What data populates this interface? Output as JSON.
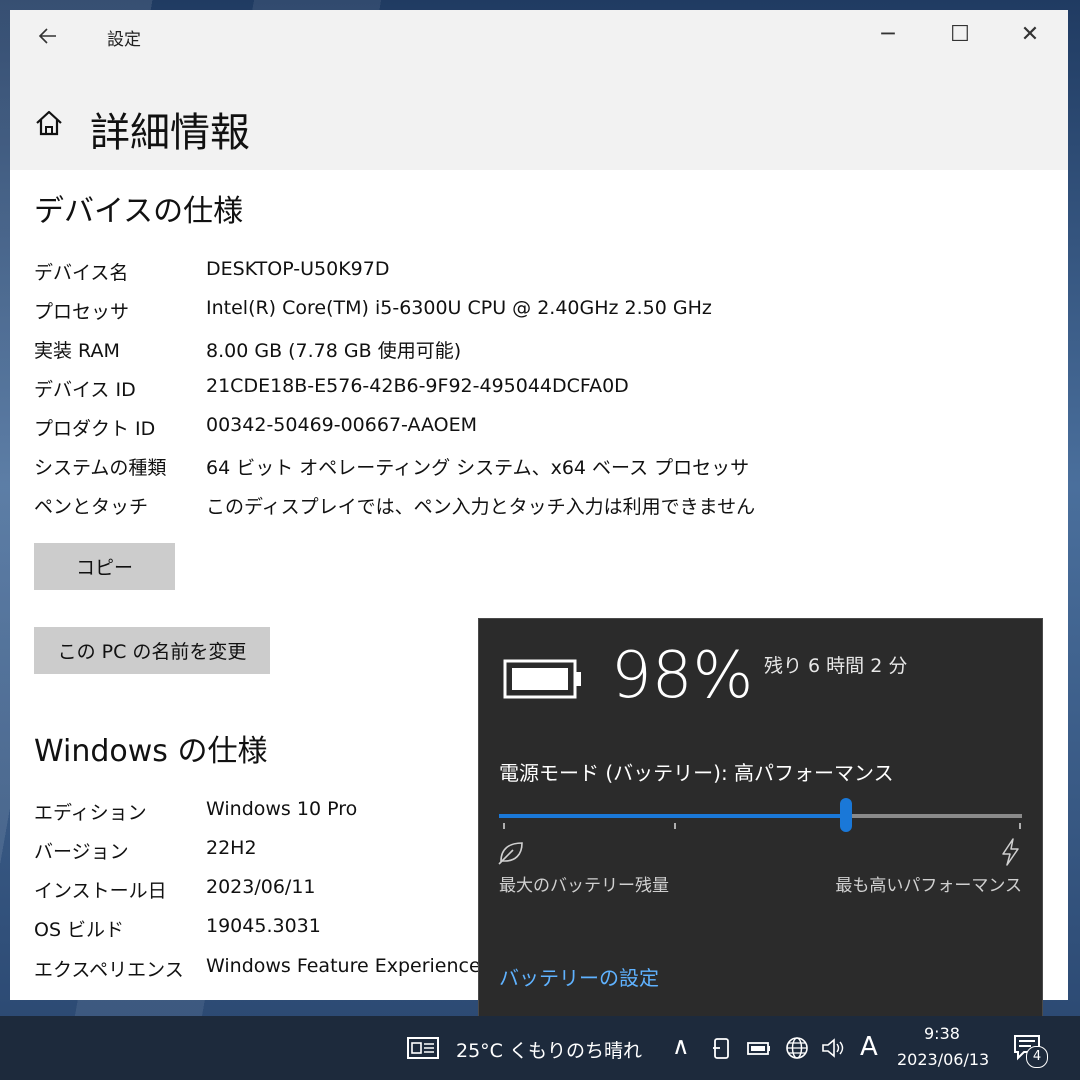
{
  "window": {
    "app_title": "設定",
    "back_icon": "back-arrow-icon",
    "minimize_glyph": "─",
    "maximize_glyph": "☐",
    "close_glyph": "✕"
  },
  "page": {
    "title": "詳細情報",
    "home_icon": "home-icon"
  },
  "device_specs": {
    "heading": "デバイスの仕様",
    "rows": [
      {
        "label": "デバイス名",
        "value": "DESKTOP-U50K97D"
      },
      {
        "label": "プロセッサ",
        "value": "Intel(R) Core(TM) i5-6300U CPU @ 2.40GHz   2.50 GHz"
      },
      {
        "label": "実装 RAM",
        "value": "8.00 GB (7.78 GB 使用可能)"
      },
      {
        "label": "デバイス ID",
        "value": "21CDE18B-E576-42B6-9F92-495044DCFA0D"
      },
      {
        "label": "プロダクト ID",
        "value": "00342-50469-00667-AAOEM"
      },
      {
        "label": "システムの種類",
        "value": "64 ビット オペレーティング システム、x64 ベース プロセッサ"
      },
      {
        "label": "ペンとタッチ",
        "value": "このディスプレイでは、ペン入力とタッチ入力は利用できません"
      }
    ],
    "copy_button": "コピー",
    "rename_button": "この PC の名前を変更"
  },
  "windows_specs": {
    "heading": "Windows の仕様",
    "rows": [
      {
        "label": "エディション",
        "value": "Windows 10 Pro"
      },
      {
        "label": "バージョン",
        "value": "22H2"
      },
      {
        "label": "インストール日",
        "value": "2023/06/11"
      },
      {
        "label": "OS ビルド",
        "value": "19045.3031"
      },
      {
        "label": "エクスペリエンス",
        "value": "Windows Feature Experience"
      }
    ]
  },
  "battery": {
    "percent": "98%",
    "remaining": "残り 6 時間 2 分",
    "power_mode_label": "電源モード (バッテリー): 高パフォーマンス",
    "slider_level": 0.667,
    "left_caption": "最大のバッテリー残量",
    "right_caption": "最も高いパフォーマンス",
    "settings_link": "バッテリーの設定",
    "accent_color": "#1a78d8"
  },
  "taskbar": {
    "weather": "25°C  くもりのち晴れ",
    "chevron": "∧",
    "ime_mode": "A",
    "time": "9:38",
    "date": "2023/06/13",
    "notification_count": "4"
  }
}
